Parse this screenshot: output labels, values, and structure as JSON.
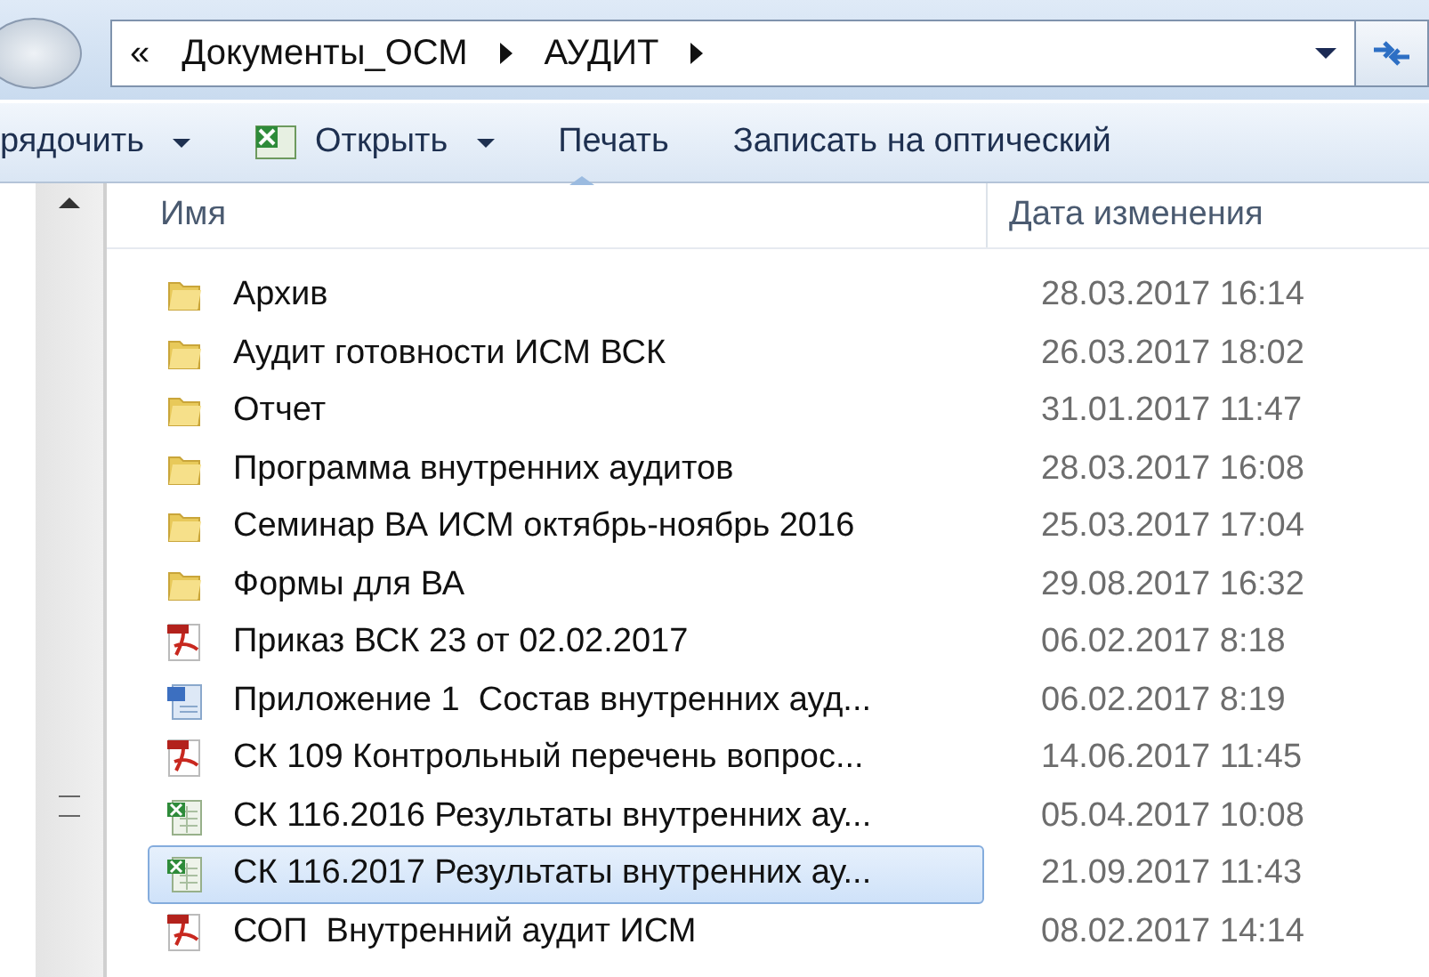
{
  "address_bar": {
    "crumbs": [
      "«",
      "Документы_ОСМ",
      "АУДИТ"
    ]
  },
  "toolbar": [
    {
      "label": "рядочить",
      "dropdown": true,
      "kind": "plain"
    },
    {
      "label": "Открыть",
      "dropdown": true,
      "kind": "excel"
    },
    {
      "label": "Печать",
      "dropdown": false,
      "kind": "plain"
    },
    {
      "label": "Записать на оптический",
      "dropdown": false,
      "kind": "plain"
    }
  ],
  "table": {
    "columns": [
      "Имя",
      "Дата изменения"
    ],
    "rows": [
      {
        "kind": "folder",
        "name": "Архив",
        "date": "28.03.2017 16:14",
        "selected": false
      },
      {
        "kind": "folder",
        "name": "Аудит готовности ИСМ ВСК",
        "date": "26.03.2017 18:02",
        "selected": false
      },
      {
        "kind": "folder",
        "name": "Отчет",
        "date": "31.01.2017 11:47",
        "selected": false
      },
      {
        "kind": "folder",
        "name": "Программа внутренних аудитов",
        "date": "28.03.2017 16:08",
        "selected": false
      },
      {
        "kind": "folder",
        "name": "Семинар ВА ИСМ октябрь-ноябрь 2016",
        "date": "25.03.2017 17:04",
        "selected": false
      },
      {
        "kind": "folder",
        "name": "Формы для ВА",
        "date": "29.08.2017 16:32",
        "selected": false
      },
      {
        "kind": "pdf",
        "name": "Приказ ВСК 23 от 02.02.2017",
        "date": "06.02.2017 8:18",
        "selected": false
      },
      {
        "kind": "word",
        "name": "Приложение 1  Состав внутренних ауд...",
        "date": "06.02.2017 8:19",
        "selected": false
      },
      {
        "kind": "pdf",
        "name": "СК 109 Контрольный перечень вопрос...",
        "date": "14.06.2017 11:45",
        "selected": false
      },
      {
        "kind": "excel",
        "name": "СК 116.2016 Результаты внутренних ау...",
        "date": "05.04.2017 10:08",
        "selected": false
      },
      {
        "kind": "excel",
        "name": "СК 116.2017 Результаты внутренних ау...",
        "date": "21.09.2017 11:43",
        "selected": true
      },
      {
        "kind": "pdf",
        "name": "СОП  Внутренний аудит ИСМ",
        "date": "08.02.2017 14:14",
        "selected": false
      }
    ]
  }
}
